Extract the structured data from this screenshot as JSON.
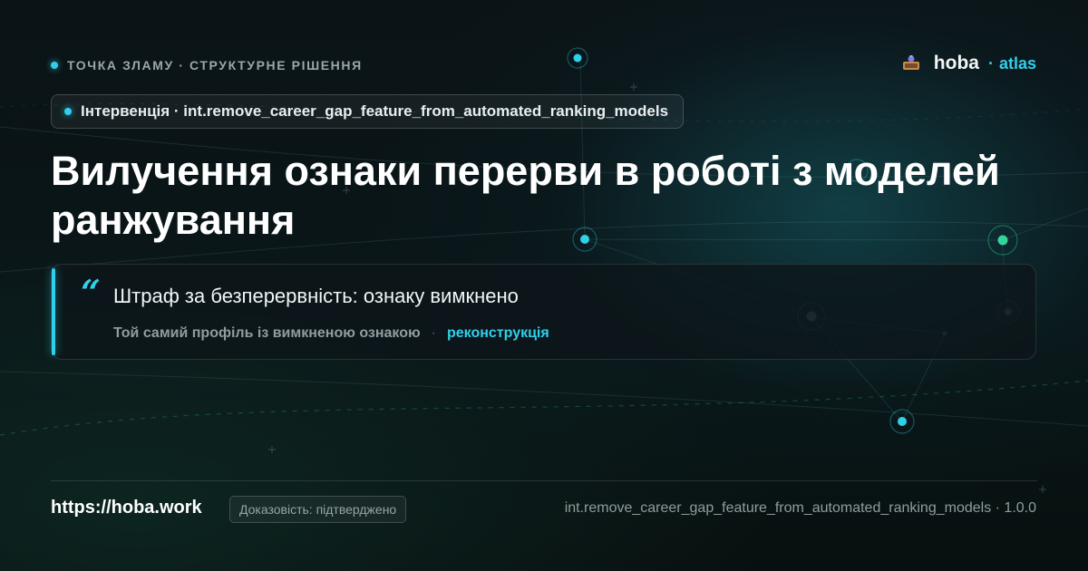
{
  "eyebrow": "ТОЧКА ЗЛАМУ · СТРУКТУРНЕ РІШЕННЯ",
  "brand": {
    "name": "hoba",
    "separator": "·",
    "sub": "atlas"
  },
  "intervention": {
    "label": "Інтервенція · int.remove_career_gap_feature_from_automated_ranking_models"
  },
  "title": "Вилучення ознаки перерви в роботі з моделей ранжування",
  "quote": {
    "mark": "“",
    "text": "Штраф за безперервність: ознаку вимкнено",
    "caption": "Той самий профіль із вимкненою ознакою",
    "separator": "·",
    "tag": "реконструкція"
  },
  "footer": {
    "url": "https://hoba.work",
    "evidence": "Доказовість: підтверджено",
    "id_version": "int.remove_career_gap_feature_from_automated_ranking_models · 1.0.0"
  },
  "colors": {
    "accent": "#2fd0ea",
    "node_green": "#34d399",
    "background": "#0a1114"
  }
}
